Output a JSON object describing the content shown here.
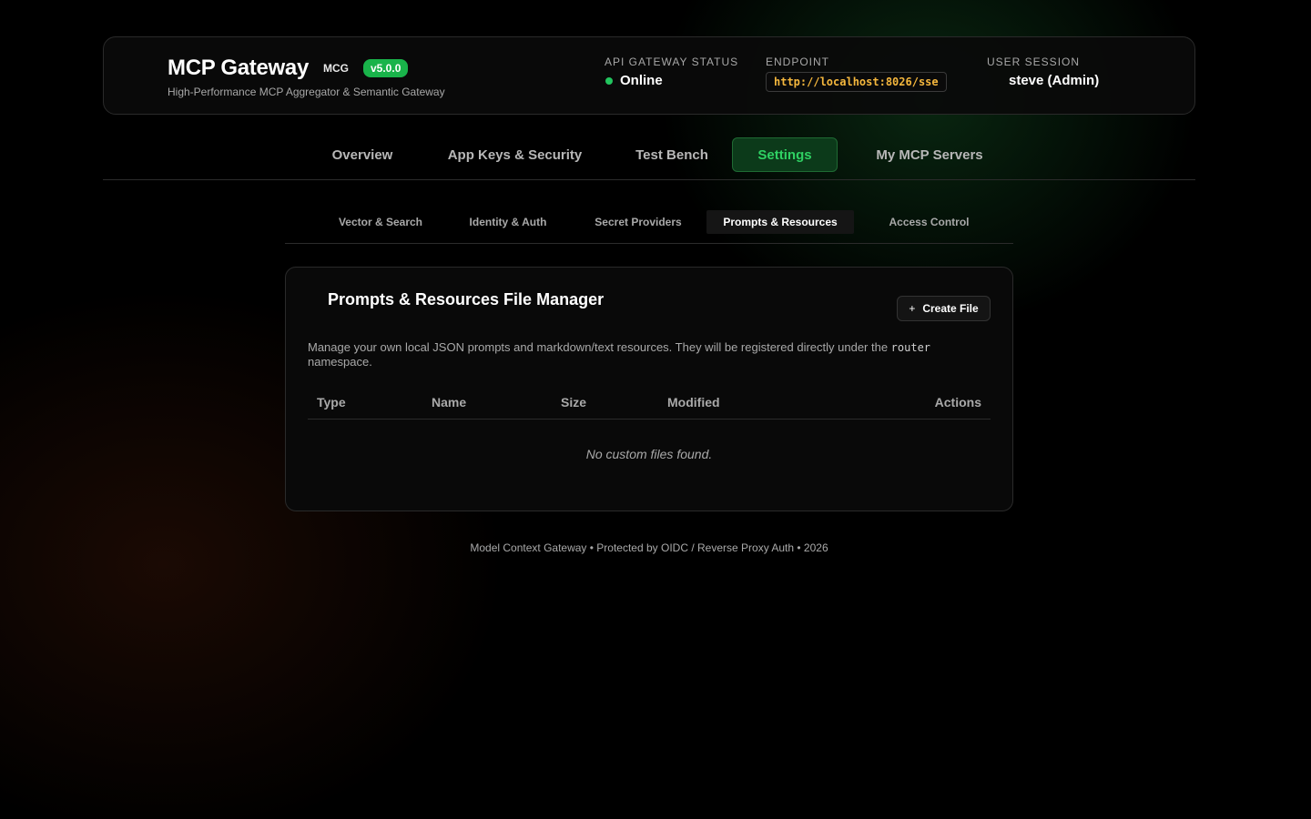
{
  "header": {
    "title": "MCP Gateway",
    "abbr": "MCG",
    "version": "v5.0.0",
    "subtitle": "High-Performance MCP Aggregator & Semantic Gateway",
    "status_label": "API GATEWAY STATUS",
    "status_value": "Online",
    "endpoint_label": "ENDPOINT",
    "endpoint_value": "http://localhost:8026/sse",
    "session_label": "USER SESSION",
    "session_value": "steve (Admin)"
  },
  "nav": {
    "items": [
      {
        "label": "Overview"
      },
      {
        "label": "App Keys & Security"
      },
      {
        "label": "Test Bench"
      },
      {
        "label": "Settings",
        "active": true
      },
      {
        "label": "My MCP Servers"
      }
    ]
  },
  "subnav": {
    "items": [
      {
        "label": "Vector & Search"
      },
      {
        "label": "Identity & Auth"
      },
      {
        "label": "Secret Providers"
      },
      {
        "label": "Prompts & Resources",
        "active": true
      },
      {
        "label": "Access Control"
      }
    ]
  },
  "panel": {
    "title": "Prompts & Resources File Manager",
    "create_plus": "+",
    "create_label": "Create File",
    "desc_before": "Manage your own local JSON prompts and markdown/text resources. They will be registered directly under the ",
    "desc_code": "router",
    "desc_after": " namespace.",
    "columns": [
      "Type",
      "Name",
      "Size",
      "Modified",
      "Actions"
    ],
    "empty_text": "No custom files found."
  },
  "footer": {
    "text": "Model Context Gateway • Protected by OIDC / Reverse Proxy Auth • 2026"
  },
  "colors": {
    "accent_green": "#22c55e",
    "badge_green": "#19b34a",
    "endpoint_amber": "#f5b73d"
  }
}
